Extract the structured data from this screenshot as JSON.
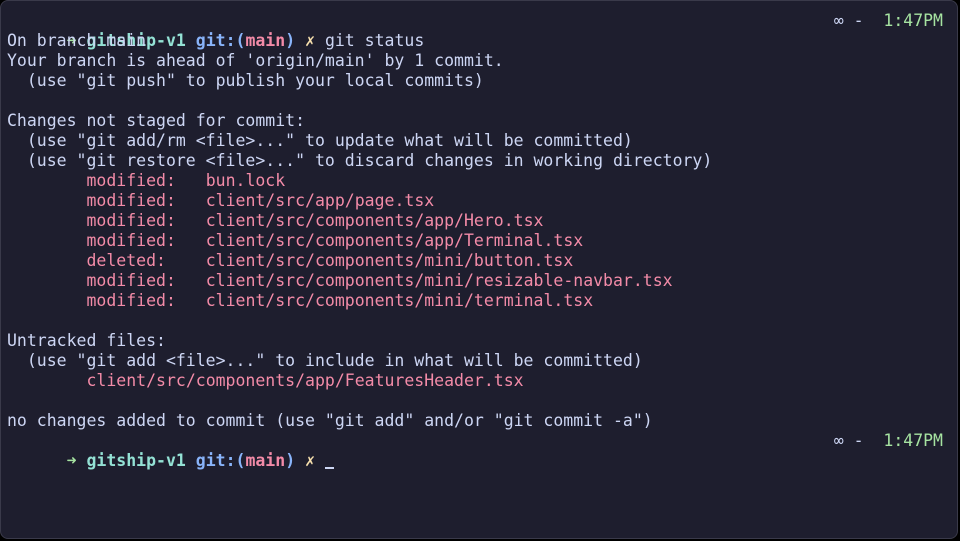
{
  "theme": {
    "background": "#1e1e2e",
    "foreground": "#cdd6f4",
    "prompt_arrow": "#a6e3a1",
    "directory": "#94e2d5",
    "git_label": "#89b4fa",
    "branch": "#f38ba8",
    "dirty_marker": "#f9e2af",
    "clock": "#a6e3a1"
  },
  "prompt": {
    "arrow": "➜",
    "directory": "gitship-v1",
    "git_prefix": "git:(",
    "branch": "main",
    "git_suffix": ")",
    "dirty_marker": "✗"
  },
  "right_prompt": {
    "symbol": "∞ -",
    "time": "1:47PM"
  },
  "command": "git status",
  "output": {
    "on_branch": "On branch main",
    "ahead": "Your branch is ahead of 'origin/main' by 1 commit.",
    "push_hint": "  (use \"git push\" to publish your local commits)",
    "not_staged_header": "Changes not staged for commit:",
    "not_staged_hint1": "  (use \"git add/rm <file>...\" to update what will be committed)",
    "not_staged_hint2": "  (use \"git restore <file>...\" to discard changes in working directory)",
    "changes": [
      {
        "status": "modified:",
        "file": "bun.lock"
      },
      {
        "status": "modified:",
        "file": "client/src/app/page.tsx"
      },
      {
        "status": "modified:",
        "file": "client/src/components/app/Hero.tsx"
      },
      {
        "status": "modified:",
        "file": "client/src/components/app/Terminal.tsx"
      },
      {
        "status": "deleted:",
        "file": "client/src/components/mini/button.tsx"
      },
      {
        "status": "modified:",
        "file": "client/src/components/mini/resizable-navbar.tsx"
      },
      {
        "status": "modified:",
        "file": "client/src/components/mini/terminal.tsx"
      }
    ],
    "untracked_header": "Untracked files:",
    "untracked_hint": "  (use \"git add <file>...\" to include in what will be committed)",
    "untracked": [
      "client/src/components/app/FeaturesHeader.tsx"
    ],
    "summary": "no changes added to commit (use \"git add\" and/or \"git commit -a\")"
  }
}
